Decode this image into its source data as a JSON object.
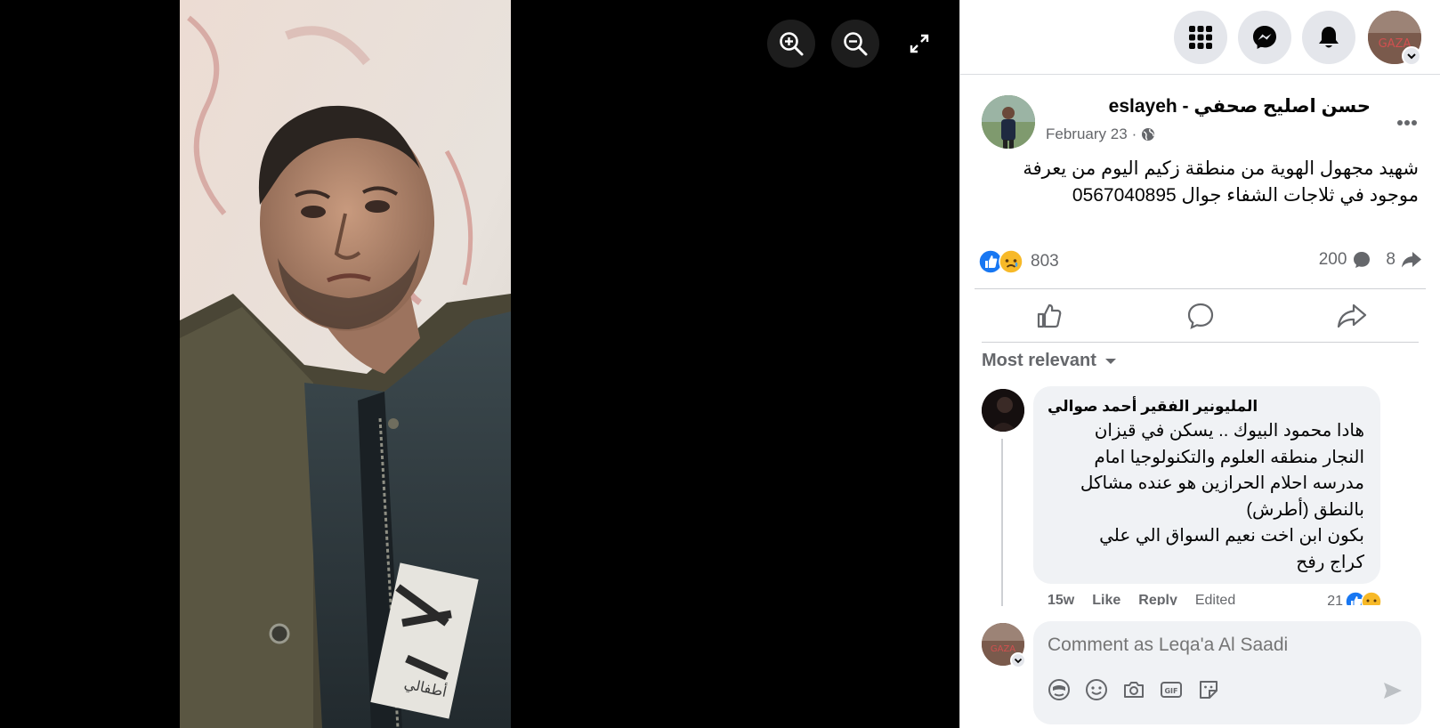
{
  "viewer": {
    "zoom_in": "zoom-in",
    "zoom_out": "zoom-out",
    "fullscreen": "fullscreen"
  },
  "photo": {
    "jacket_text": "أطفالي"
  },
  "topbar": {
    "menu_icon": "grid-menu-icon",
    "messenger_icon": "messenger-icon",
    "notifications_icon": "bell-icon",
    "profile_avatar_text": "GAZA"
  },
  "post": {
    "author": "حسن اصليح صحفي - eslayeh",
    "date": "February 23",
    "separator": "·",
    "privacy_icon": "globe-icon",
    "more": "...",
    "text_line1": "شهيد مجهول الهوية من منطقة زكيم اليوم من يعرفة",
    "text_line2": "موجود في ثلاجات الشفاء جوال 0567040895",
    "reactions_count": "803",
    "comments_count": "200",
    "shares_count": "8"
  },
  "actions": {
    "like_icon": "like-icon",
    "comment_icon": "comment-icon",
    "share_icon": "share-icon"
  },
  "filter": {
    "label": "Most relevant"
  },
  "comment": {
    "author": "المليونير الفقير أحمد صوالي",
    "lines": [
      "هادا محمود البيوك .. يسكن في قيزان",
      "النجار منطقه العلوم والتكنولوجيا امام",
      "مدرسه احلام الحرازين هو عنده مشاكل",
      "بالنطق (أطرش)",
      "بكون ابن اخت نعيم السواق الي علي",
      "كراج رفح"
    ],
    "time": "15w",
    "like": "Like",
    "reply": "Reply",
    "edited": "Edited",
    "reactions": "21"
  },
  "composer": {
    "placeholder": "Comment as Leqa'a Al Saadi",
    "avatar_text": "GAZA",
    "icons": [
      "avatar-sticker-icon",
      "emoji-icon",
      "camera-icon",
      "gif-icon",
      "sticker-icon"
    ],
    "gif_text": "GIF",
    "send_icon": "send-icon"
  },
  "colors": {
    "accent": "#1877f2",
    "bubble": "#f0f2f5",
    "muted": "#65676b"
  }
}
